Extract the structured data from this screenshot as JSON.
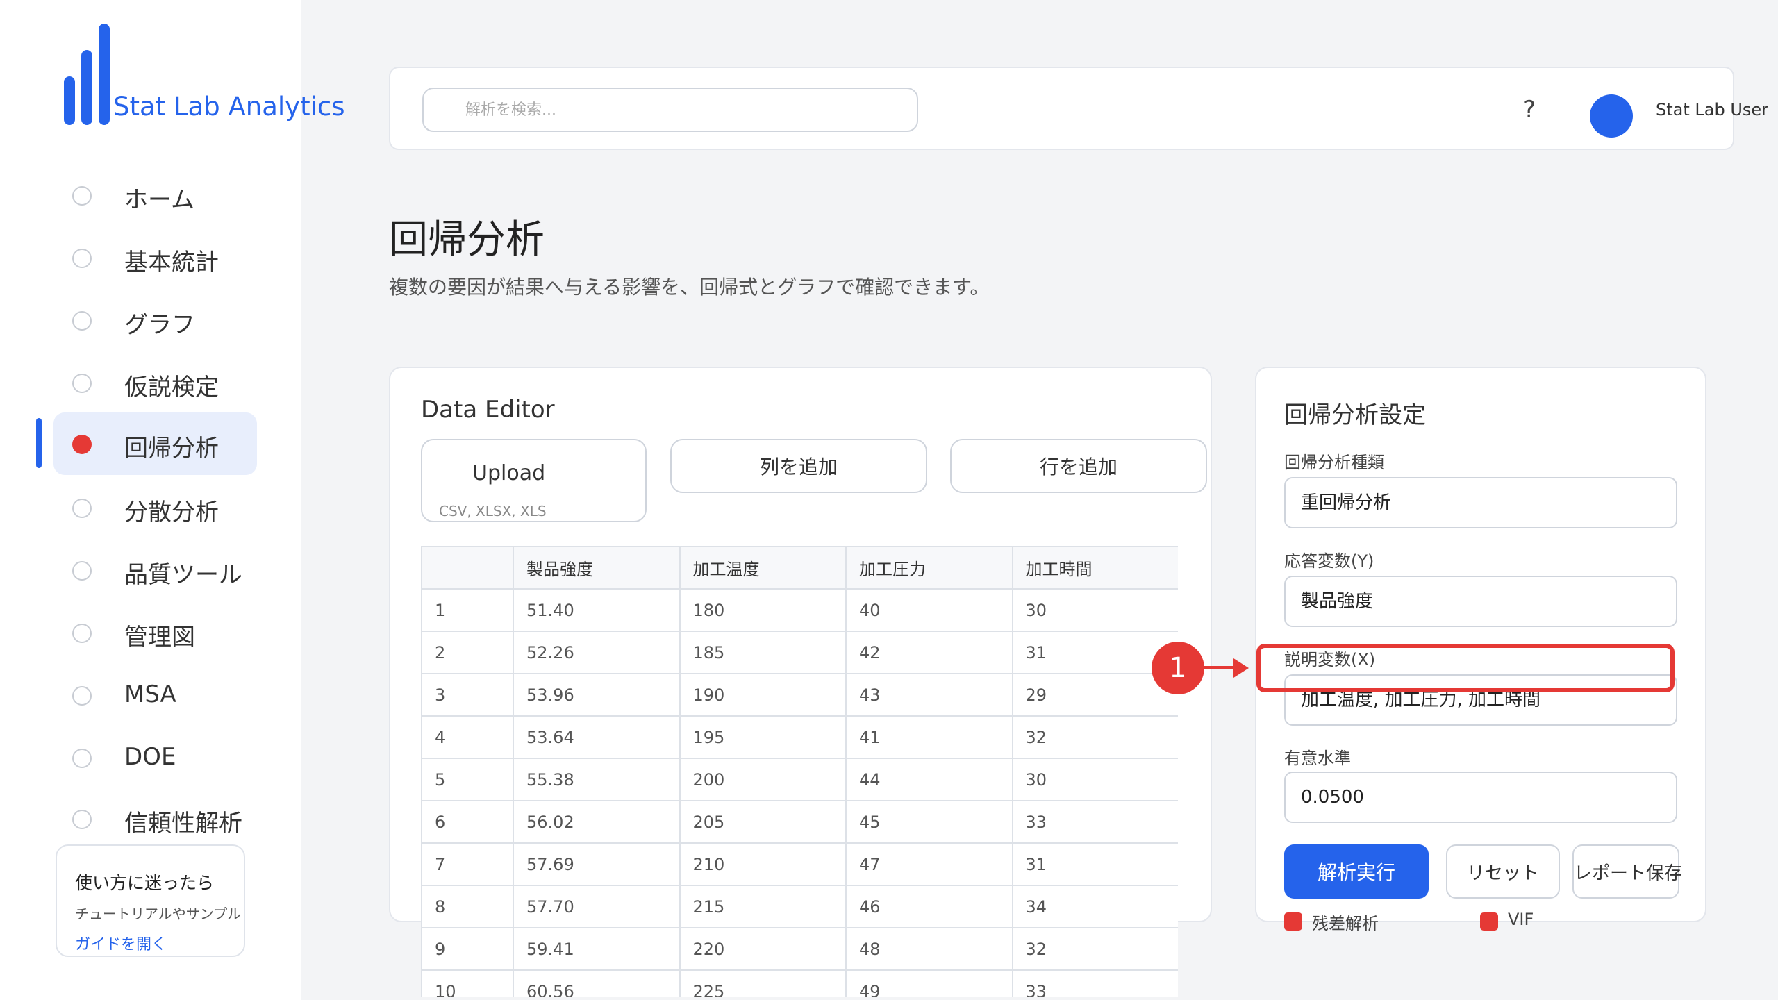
{
  "app": {
    "name": "Stat Lab Analytics",
    "accent_color": "#2563eb",
    "alert_color": "#e53935"
  },
  "sidebar": {
    "items": [
      {
        "label": "ホーム"
      },
      {
        "label": "基本統計"
      },
      {
        "label": "グラフ"
      },
      {
        "label": "仮説検定"
      },
      {
        "label": "回帰分析",
        "active": true
      },
      {
        "label": "分散分析"
      },
      {
        "label": "品質ツール"
      },
      {
        "label": "管理図"
      },
      {
        "label": "MSA"
      },
      {
        "label": "DOE"
      },
      {
        "label": "信頼性解析"
      }
    ],
    "help": {
      "title": "使い方に迷ったら",
      "description": "チュートリアルやサンプル",
      "link": "ガイドを開く"
    }
  },
  "header": {
    "search_placeholder": "解析を検索...",
    "help_icon": "?",
    "user_name": "Stat Lab User"
  },
  "page": {
    "title": "回帰分析",
    "subtitle": "複数の要因が結果へ与える影響を、回帰式とグラフで確認できます。"
  },
  "data_editor": {
    "title": "Data Editor",
    "upload_label": "Upload",
    "upload_formats": "CSV, XLSX, XLS",
    "add_column_label": "列を追加",
    "add_row_label": "行を追加",
    "columns": [
      "",
      "製品強度",
      "加工温度",
      "加工圧力",
      "加工時間"
    ],
    "rows": [
      [
        "1",
        "51.40",
        "180",
        "40",
        "30"
      ],
      [
        "2",
        "52.26",
        "185",
        "42",
        "31"
      ],
      [
        "3",
        "53.96",
        "190",
        "43",
        "29"
      ],
      [
        "4",
        "53.64",
        "195",
        "41",
        "32"
      ],
      [
        "5",
        "55.38",
        "200",
        "44",
        "30"
      ],
      [
        "6",
        "56.02",
        "205",
        "45",
        "33"
      ],
      [
        "7",
        "57.69",
        "210",
        "47",
        "31"
      ],
      [
        "8",
        "57.70",
        "215",
        "46",
        "34"
      ],
      [
        "9",
        "59.41",
        "220",
        "48",
        "32"
      ],
      [
        "10",
        "60.56",
        "225",
        "49",
        "33"
      ]
    ]
  },
  "settings": {
    "title": "回帰分析設定",
    "type_label": "回帰分析種類",
    "type_value": "重回帰分析",
    "response_label": "応答変数(Y)",
    "response_value": "製品強度",
    "explanatory_label": "説明変数(X)",
    "explanatory_value": "加工温度, 加工圧力, 加工時間",
    "significance_label": "有意水準",
    "significance_value": "0.0500",
    "run_label": "解析実行",
    "reset_label": "リセット",
    "save_label": "レポート保存",
    "options": [
      {
        "label": "残差解析"
      },
      {
        "label": "VIF"
      }
    ]
  },
  "annotation": {
    "number": "1"
  }
}
